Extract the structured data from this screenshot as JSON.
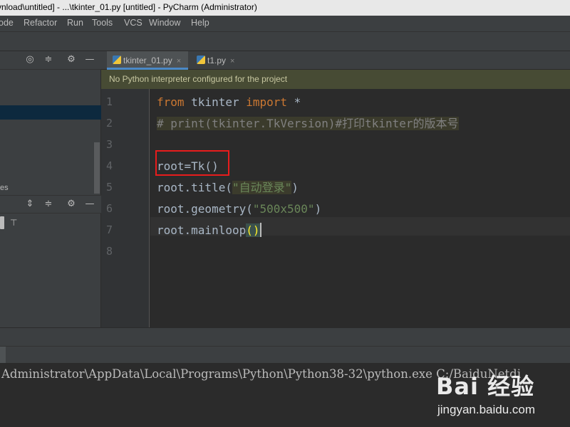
{
  "window": {
    "title": "vnload\\untitled] - ...\\tkinter_01.py [untitled] - PyCharm (Administrator)"
  },
  "menu": [
    {
      "label": "ode"
    },
    {
      "label": "Refactor"
    },
    {
      "label": "Run"
    },
    {
      "label": "Tools"
    },
    {
      "label": "VCS"
    },
    {
      "label": "Window"
    },
    {
      "label": "Help"
    }
  ],
  "left_panel": {
    "truncated_label": "es",
    "header_icons": [
      "target-icon",
      "collapse-icon",
      "gear-icon",
      "minimize-icon"
    ],
    "lower_header_icons": [
      "expand-icon",
      "collapse-icon",
      "gear-icon",
      "minimize-icon"
    ]
  },
  "tabs": [
    {
      "label": "tkinter_01.py",
      "close": "×",
      "active": true
    },
    {
      "label": "t1.py",
      "close": "×",
      "active": false
    }
  ],
  "banner": {
    "text": "No Python interpreter configured for the project"
  },
  "editor": {
    "line_numbers": [
      "1",
      "2",
      "3",
      "4",
      "5",
      "6",
      "7",
      "8"
    ],
    "lines": {
      "l1_kw1": "from",
      "l1_mid": " tkinter ",
      "l1_kw2": "import",
      "l1_end": " *",
      "l2": "# print(tkinter.TkVersion)#打印tkinter的版本号",
      "l4": "root=Tk()",
      "l5_pre": "root.title(",
      "l5_str": "\"自动登录\"",
      "l5_post": ")",
      "l6_pre": "root.geometry(",
      "l6_str": "\"500x500\"",
      "l6_post": ")",
      "l7_pre": "root.mainloop",
      "l7_paren": "()"
    }
  },
  "console": {
    "text": "Administrator\\AppData\\Local\\Programs\\Python\\Python38-32\\python.exe C:/BaiduNetdi"
  },
  "watermark": {
    "logo": "Bai 经验",
    "url": "jingyan.baidu.com"
  },
  "colors": {
    "keyword": "#cc7832",
    "comment": "#808080",
    "string": "#6a8759",
    "identifier": "#a9b7c6",
    "banner_bg": "#474b34",
    "highlight_box": "#e81c1c"
  }
}
